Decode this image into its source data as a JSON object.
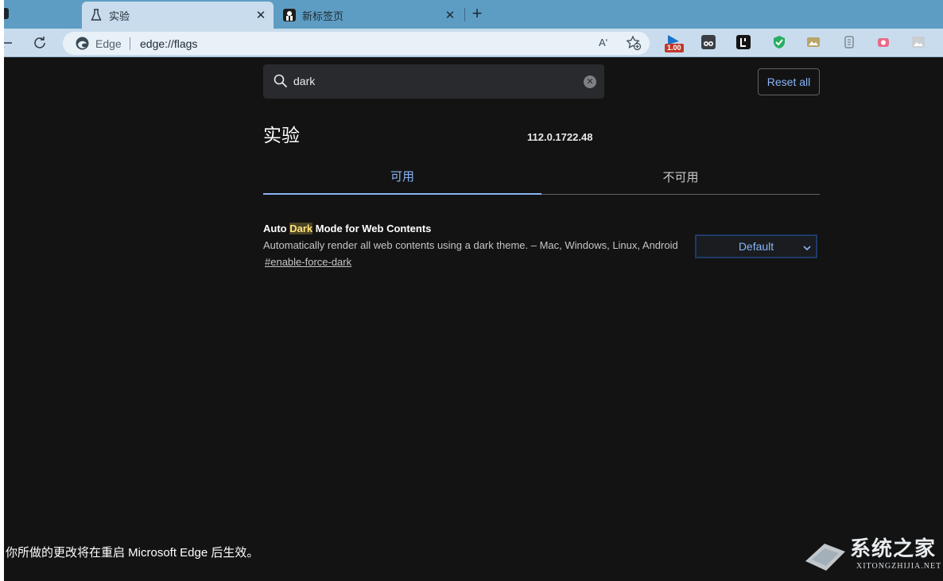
{
  "tabs": {
    "active": {
      "title": "实验",
      "icon": "beaker-icon"
    },
    "second": {
      "title": "新标签页",
      "icon": "app-icon"
    },
    "close_glyph": "✕",
    "new_tab_glyph": "+"
  },
  "toolbar": {
    "site_name": "Edge",
    "url": "edge://flags",
    "read_aloud_glyph": "Aʹ"
  },
  "extensions": {
    "badge_label": "1.00"
  },
  "search": {
    "value": "dark",
    "clear_glyph": "✕"
  },
  "reset_button": "Reset all",
  "page": {
    "title": "实验",
    "version": "112.0.1722.48"
  },
  "content_tabs": {
    "available": "可用",
    "unavailable": "不可用"
  },
  "flag": {
    "name_before": "Auto ",
    "name_highlight": "Dark",
    "name_after": " Mode for Web Contents",
    "description": "Automatically render all web contents using a dark theme. – Mac, Windows, Linux, Android",
    "link": "#enable-force-dark",
    "selected_option": "Default"
  },
  "restart_message": "你所做的更改将在重启 Microsoft Edge 后生效。",
  "watermark": {
    "text": "系统之家",
    "sub": "XITONGZHIJIA.NET"
  },
  "colors": {
    "background": "#131313",
    "accent": "#8ab4f8",
    "tabstrip": "#5e9dc3",
    "toolbar": "#c9dced"
  }
}
